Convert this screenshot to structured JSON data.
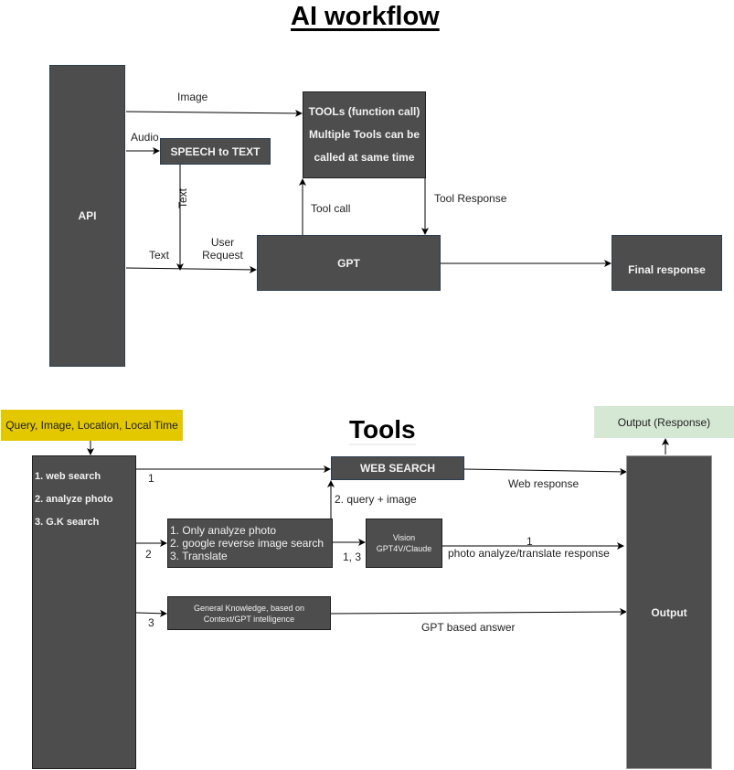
{
  "section1": {
    "title": "AI workflow",
    "nodes": {
      "api": "API",
      "speech_to_text": "SPEECH to TEXT",
      "tools": [
        "TOOLs (function call)",
        "Multiple Tools can be",
        "called at same time"
      ],
      "gpt": "GPT",
      "final_response": "Final response"
    },
    "edge_labels": {
      "image": "Image",
      "audio": "Audio",
      "text_vertical": "Text",
      "text": "Text",
      "user_request": [
        "User",
        "Request"
      ],
      "tool_call": "Tool call",
      "tool_response": "Tool Response"
    }
  },
  "section2": {
    "title": "Tools",
    "nodes": {
      "input": "Query, Image, Location, Local Time",
      "router": [
        "1. web search",
        "2. analyze photo",
        "3. G.K  search"
      ],
      "web_search": "WEB SEARCH",
      "photo_tasks": [
        "1. Only analyze photo",
        "2. google reverse image search",
        "3. Translate"
      ],
      "vision": [
        "Vision",
        "GPT4V/Claude"
      ],
      "general_knowledge": [
        "General Knowledge, based on",
        "Context/GPT intelligence"
      ],
      "output": "Output",
      "output_response": "Output (Response)"
    },
    "edge_labels": {
      "route_1": "1",
      "route_2": "2",
      "route_3": "3",
      "query_image": "2. query + image",
      "vision_in": "1, 3",
      "web_response": "Web response",
      "vision_out_num": "1",
      "vision_out": "photo analyze/translate response",
      "gpt_answer": "GPT based answer"
    }
  },
  "colors": {
    "node_fill": "#4d4d4d",
    "node_text": "#f2f2f2",
    "input_fill": "#e3c800",
    "output_response_fill": "#d5e8d4",
    "wire": "#000000"
  }
}
